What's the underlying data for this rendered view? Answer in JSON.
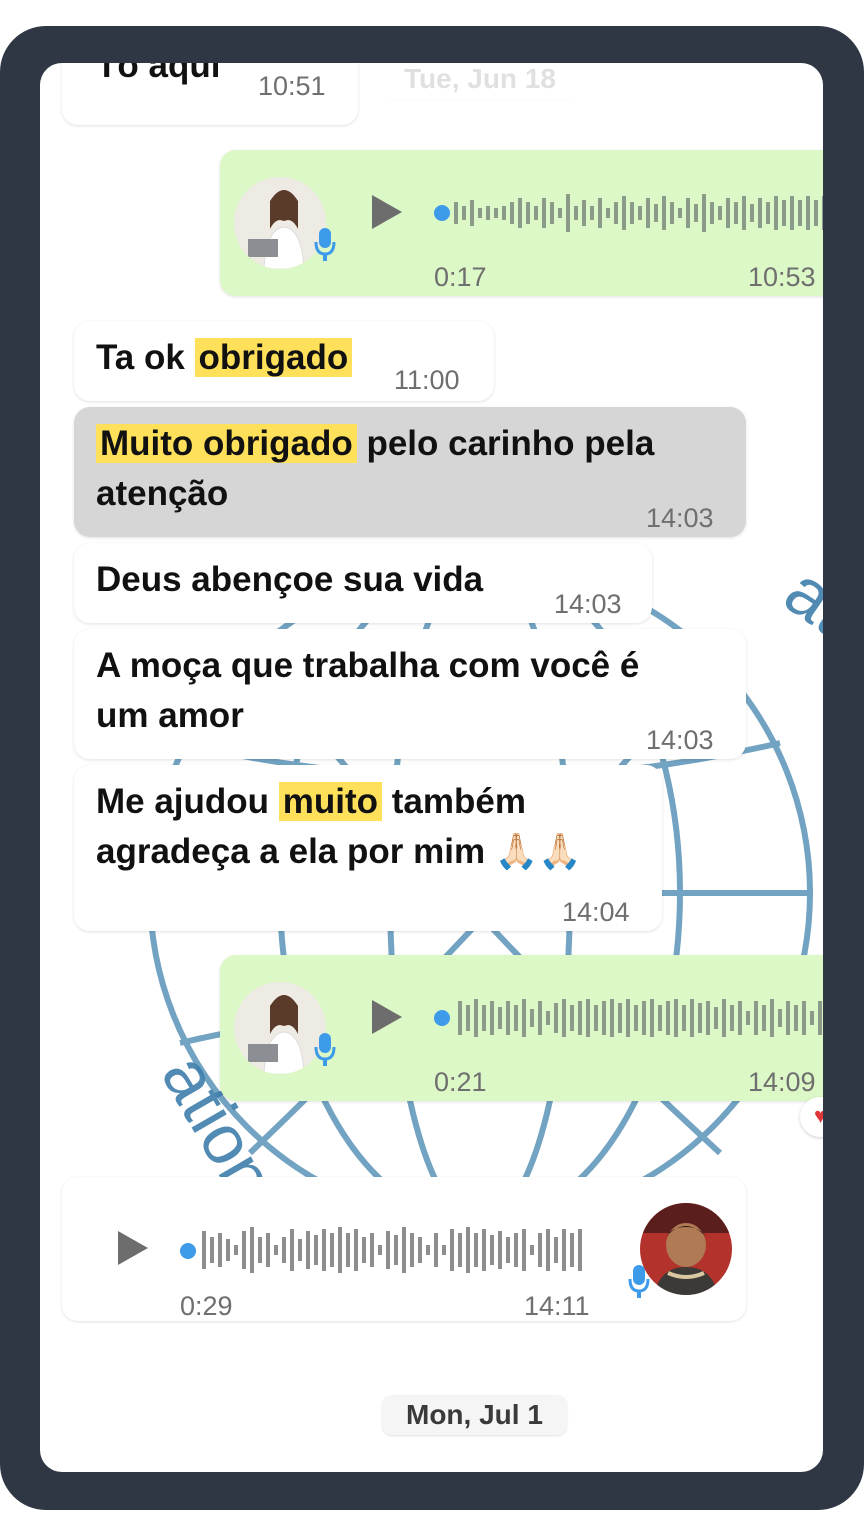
{
  "date_headers": {
    "top_faded": "Tue, Jun 18",
    "bottom": "Mon, Jul 1"
  },
  "messages": [
    {
      "text": "Tô aqui",
      "time": "10:51"
    },
    {
      "duration": "0:17",
      "time": "10:53"
    },
    {
      "text_a": "Ta ok ",
      "text_hl": "obrigado",
      "time": "11:00"
    },
    {
      "text_hl": "Muito obrigado",
      "text_b": " pelo carinho pela",
      "line2": "atenção",
      "time": "14:03"
    },
    {
      "text": "Deus abençoe sua vida",
      "time": "14:03"
    },
    {
      "line1": "A moça que trabalha com você é",
      "line2": "um amor",
      "time": "14:03"
    },
    {
      "text_a": "Me ajudou ",
      "text_hl": "muito",
      "text_b": " também",
      "line2": "agradeça a ela por mim 🙏🏻🙏🏻",
      "time": "14:04"
    },
    {
      "duration": "0:21",
      "time": "14:09"
    },
    {
      "duration": "0:29",
      "time": "14:11"
    }
  ],
  "icons": {
    "play": "play-icon",
    "mic": "microphone-icon",
    "reaction": "heart-reaction-icon"
  },
  "colors": {
    "frame": "#2e3743",
    "outgoing": "#dcf8c6",
    "highlight": "#ffe05a",
    "selected": "#d6d6d6",
    "voice_dot": "#3d9be9"
  }
}
